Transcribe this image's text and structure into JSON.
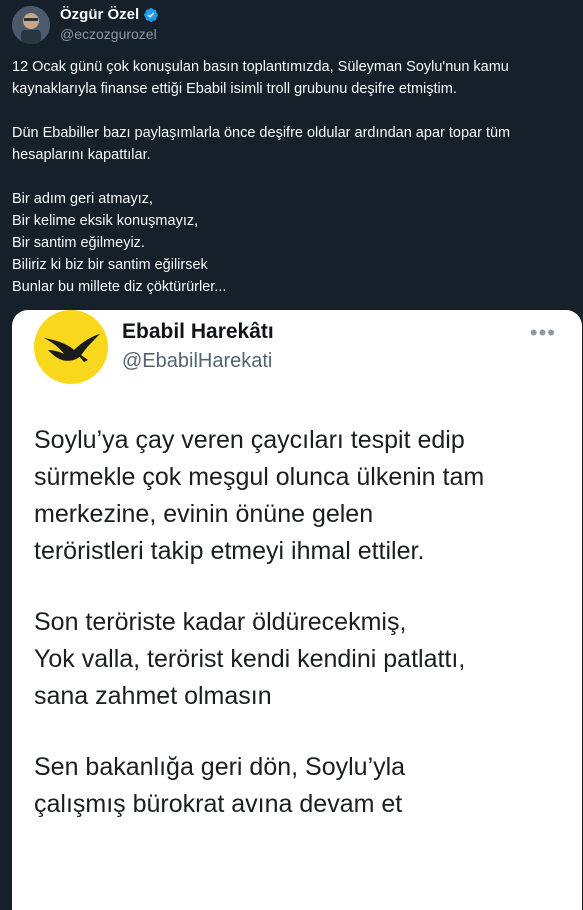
{
  "author": {
    "name": "Özgür Özel",
    "handle": "@eczozgurozel"
  },
  "tweet": {
    "paragraphs": [
      "12 Ocak günü çok konuşulan basın toplantımızda, Süleyman Soylu'nun kamu kaynaklarıyla finanse ettiği Ebabil isimli troll grubunu deşifre etmiştim.",
      "Dün Ebabiller bazı paylaşımlarla önce deşifre oldular ardından apar topar tüm hesaplarını kapattılar."
    ],
    "lines": [
      "Bir adım geri atmayız,",
      "Bir kelime eksik konuşmayız,",
      "Bir santim eğilmeyiz.",
      "Biliriz ki biz bir santim eğilirsek",
      "Bunlar bu millete diz çöktürürler..."
    ]
  },
  "quoted_card": {
    "name": "Ebabil Harekâtı",
    "handle": "@EbabilHarekati",
    "more": "•••",
    "lines": [
      "Soylu’ya çay veren çaycıları tespit edip",
      "sürmekle çok meşgul olunca ülkenin tam",
      "merkezine, evinin önüne gelen",
      "teröristleri takip etmeyi ihmal ettiler.",
      "Son teröriste kadar öldürecekmiş,",
      "Yok valla, terörist kendi kendini patlattı,",
      "sana zahmet olmasın",
      "Sen bakanlığa geri dön, Soylu’yla",
      "çalışmış bürokrat avına devam et"
    ]
  },
  "colors": {
    "background": "#15202b",
    "verified": "#1d9bf0",
    "logo_yellow": "#f9d71c"
  }
}
